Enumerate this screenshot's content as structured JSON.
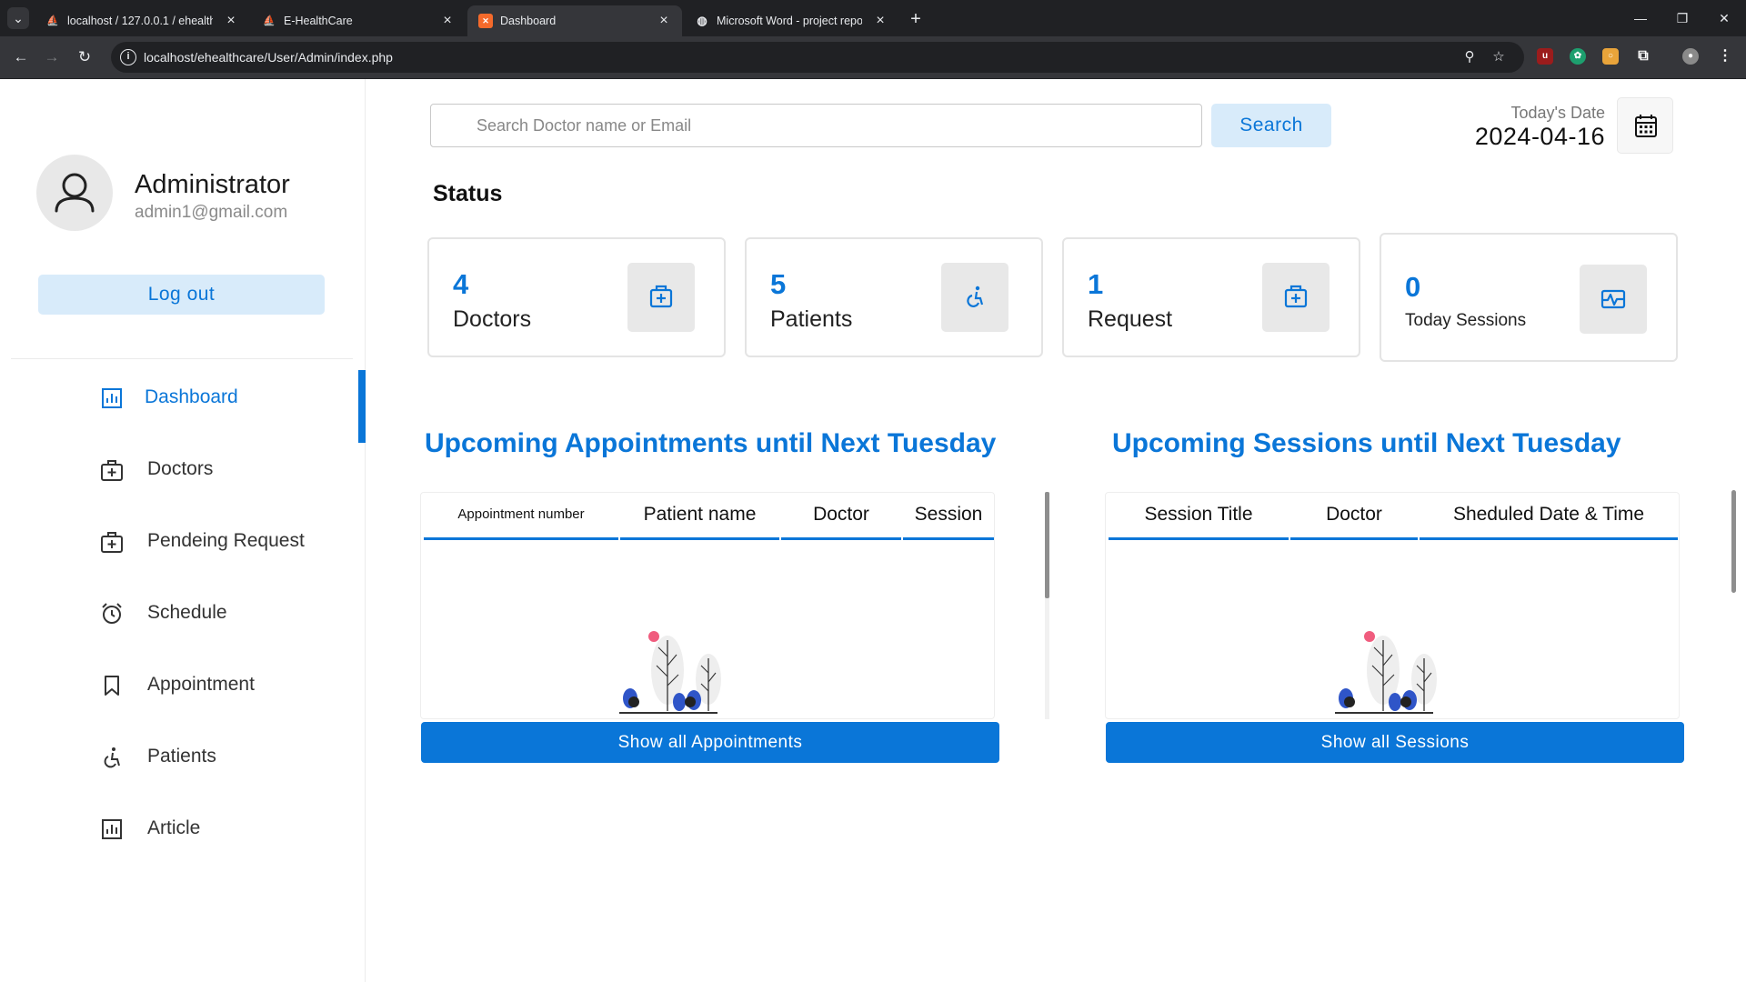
{
  "browser": {
    "tabs": [
      {
        "title": "localhost / 127.0.0.1 / ehealthcare",
        "active": false
      },
      {
        "title": "E-HealthCare",
        "active": false
      },
      {
        "title": "Dashboard",
        "active": true
      },
      {
        "title": "Microsoft Word - project report",
        "active": false
      }
    ],
    "url": "localhost/ehealthcare/User/Admin/index.php"
  },
  "user": {
    "name": "Administrator",
    "email": "admin1@gmail.com",
    "logout_label": "Log out"
  },
  "menu": {
    "items": [
      {
        "label": "Dashboard",
        "icon": "dashboard-icon",
        "active": true
      },
      {
        "label": "Doctors",
        "icon": "medical-case-icon",
        "active": false
      },
      {
        "label": "Pendeing Request",
        "icon": "medical-case-icon",
        "active": false
      },
      {
        "label": "Schedule",
        "icon": "alarm-clock-icon",
        "active": false
      },
      {
        "label": "Appointment",
        "icon": "bookmark-icon",
        "active": false
      },
      {
        "label": "Patients",
        "icon": "wheelchair-icon",
        "active": false
      },
      {
        "label": "Article",
        "icon": "chart-icon",
        "active": false
      }
    ]
  },
  "search": {
    "placeholder": "Search Doctor name or Email",
    "button_label": "Search"
  },
  "date": {
    "label": "Today's Date",
    "value": "2024-04-16"
  },
  "status": {
    "title": "Status",
    "cards": [
      {
        "number": "4",
        "label": "Doctors",
        "icon": "medical-case-icon"
      },
      {
        "number": "5",
        "label": "Patients",
        "icon": "wheelchair-icon"
      },
      {
        "number": "1",
        "label": "Request",
        "icon": "medical-case-icon"
      },
      {
        "number": "0",
        "label": "Today Sessions",
        "icon": "pulse-icon"
      }
    ]
  },
  "appointments": {
    "title": "Upcoming Appointments until Next Tuesday",
    "columns": [
      "Appointment number",
      "Patient name",
      "Doctor",
      "Session"
    ],
    "button_label": "Show all Appointments"
  },
  "sessions": {
    "title": "Upcoming Sessions until Next Tuesday",
    "columns": [
      "Session Title",
      "Doctor",
      "Sheduled Date & Time"
    ],
    "button_label": "Show all Sessions"
  },
  "colors": {
    "accent": "#0a76d8",
    "accent_light": "#d8ebfa",
    "browser_dark": "#202124"
  }
}
